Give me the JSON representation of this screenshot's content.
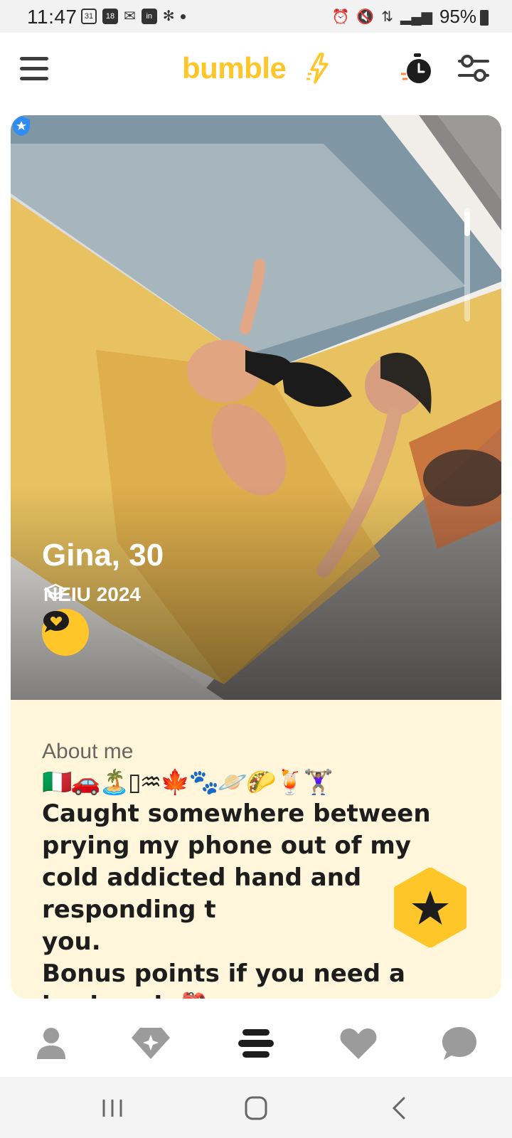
{
  "status_bar": {
    "time": "11:47",
    "calendar_day": "31",
    "calendar_small": "18",
    "battery": "95%"
  },
  "header": {
    "logo": "bumble",
    "accent_color": "#ffc629"
  },
  "profile": {
    "name_age": "Gina, 30",
    "education": "NEIU 2024",
    "verified": true
  },
  "about": {
    "title": "About me",
    "emojis": "🇮🇹🚗🏝️▯♒🍁🐾🪐🌮🍹🏋🏽‍♀️",
    "bio_line1": "Caught somewhere between prying my phone out of my cold addicted hand and responding t",
    "bio_line1_tail": "you.",
    "bio_line2": "Bonus points if you need a backpack 🎒"
  },
  "bottom_nav": {
    "items": [
      "profile",
      "discover",
      "people",
      "liked-you",
      "chats"
    ],
    "active": "people"
  },
  "icons": {
    "menu": "hamburger-icon",
    "timer": "stopwatch-icon",
    "filter": "sliders-icon",
    "verified": "verified-badge-icon",
    "chat": "chat-bubble-heart-icon",
    "superswipe": "star-hexagon-icon"
  }
}
